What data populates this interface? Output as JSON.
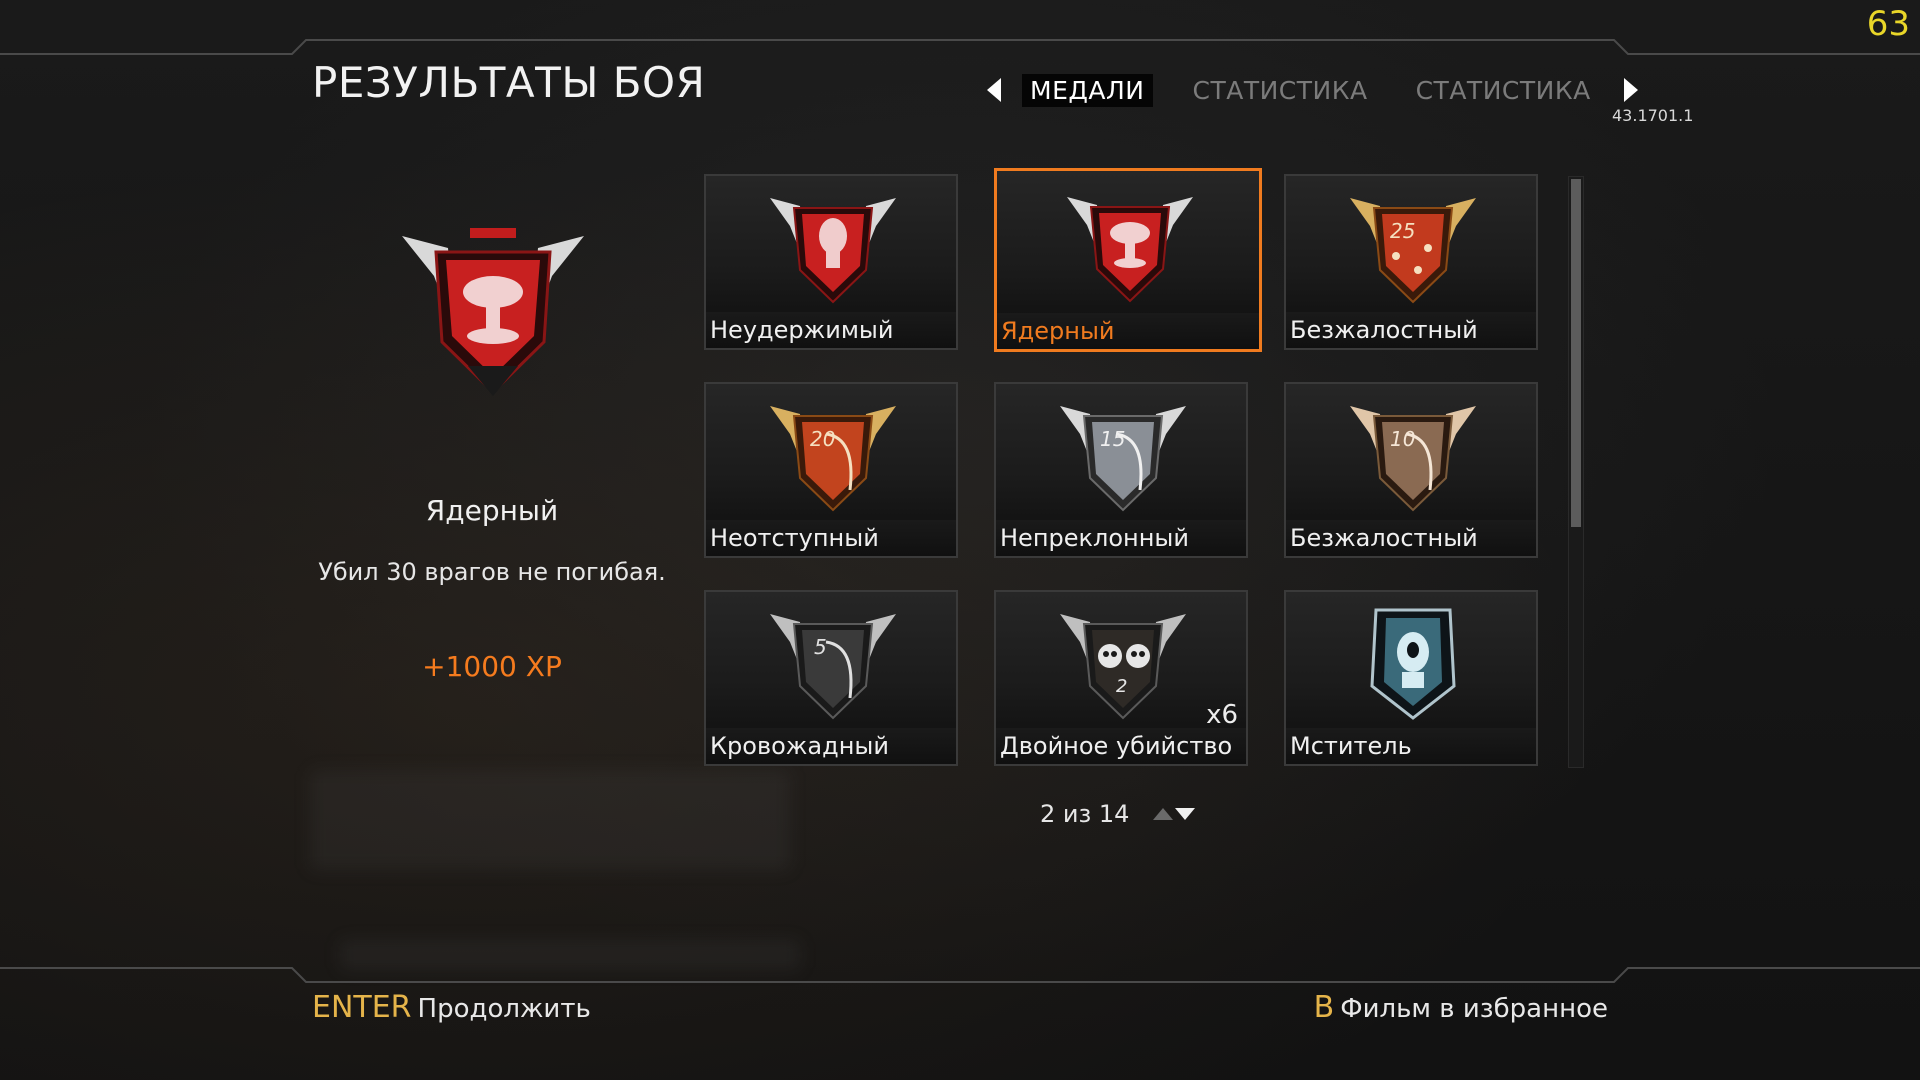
{
  "overlay": {
    "fps": "63",
    "version": "43.1701.1"
  },
  "header": {
    "title": "РЕЗУЛЬТАТЫ БОЯ",
    "tabs": [
      {
        "label": "МЕДАЛИ",
        "active": true
      },
      {
        "label": "СТАТИСТИКА",
        "active": false
      },
      {
        "label": "СТАТИСТИКА",
        "active": false
      }
    ]
  },
  "detail": {
    "name": "Ядерный",
    "description": "Убил 30 врагов не погибая.",
    "xp": "+1000 XP",
    "icon": "nuke-medal-icon"
  },
  "medals": [
    {
      "name": "Неудержимый",
      "icon": "unstoppable-medal-icon",
      "count": ""
    },
    {
      "name": "Ядерный",
      "icon": "nuke-medal-icon",
      "count": "",
      "selected": true
    },
    {
      "name": "Безжалостный",
      "icon": "ruthless-25-medal-icon",
      "count": ""
    },
    {
      "name": "Неотступный",
      "icon": "relentless-20-medal-icon",
      "count": ""
    },
    {
      "name": "Непреклонный",
      "icon": "merciless-15-medal-icon",
      "count": ""
    },
    {
      "name": "Безжалостный",
      "icon": "ruthless-10-medal-icon",
      "count": ""
    },
    {
      "name": "Кровожадный",
      "icon": "bloodthirsty-5-medal-icon",
      "count": ""
    },
    {
      "name": "Двойное убийство",
      "icon": "double-kill-medal-icon",
      "count": "x6"
    },
    {
      "name": "Мститель",
      "icon": "avenger-medal-icon",
      "count": ""
    }
  ],
  "pager": {
    "text": "2 из 14"
  },
  "footer": {
    "continue_key": "ENTER",
    "continue_label": "Продолжить",
    "bookmark_key": "B",
    "bookmark_label": "Фильм в избранное"
  },
  "colors": {
    "accent": "#f07b1f",
    "key": "#e5b44a",
    "fps": "#e9d629"
  }
}
